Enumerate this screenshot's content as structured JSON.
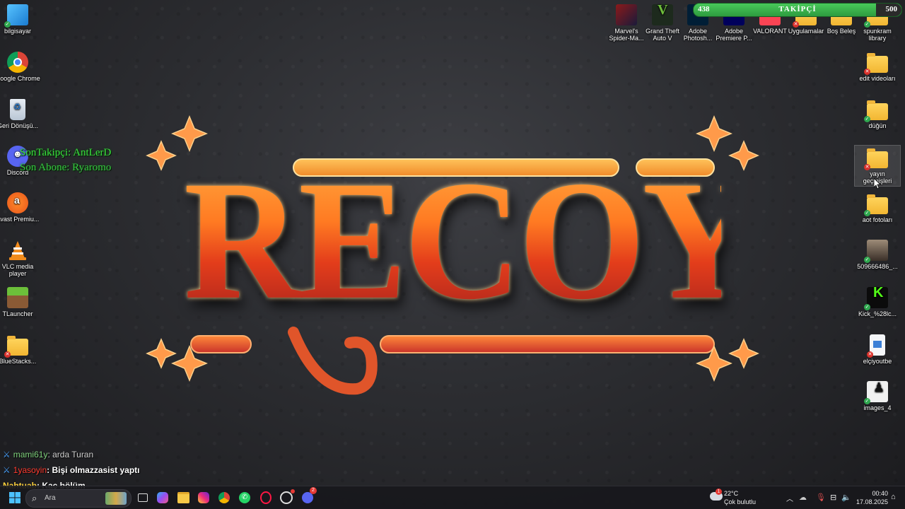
{
  "logo": {
    "text": "RECOYiN"
  },
  "desktop_left": [
    {
      "id": "bilgisayar",
      "label": "bilgisayar",
      "status": "ok"
    },
    {
      "id": "chrome",
      "label": "Google Chrome",
      "status": "shortcut"
    },
    {
      "id": "recycle",
      "label": "Geri Dönüşü...",
      "status": "none"
    },
    {
      "id": "discord",
      "label": "Discord",
      "status": "shortcut"
    },
    {
      "id": "avast",
      "label": "Avast Premiu...",
      "status": "shortcut"
    },
    {
      "id": "vlc",
      "label": "VLC media player",
      "status": "shortcut"
    },
    {
      "id": "tlauncher",
      "label": "TLauncher",
      "status": "shortcut"
    },
    {
      "id": "bluestacks",
      "label": "BlueStacks...",
      "status": "err"
    }
  ],
  "desktop_top": [
    {
      "id": "spiderman",
      "label": "Marvel's Spider-Ma..."
    },
    {
      "id": "gta",
      "label": "Grand Theft Auto V"
    },
    {
      "id": "photoshop",
      "label": "Adobe Photosh..."
    },
    {
      "id": "premiere",
      "label": "Adobe Premiere P..."
    },
    {
      "id": "valorant",
      "label": "VALORANT"
    },
    {
      "id": "uygulamalar",
      "label": "Uygulamalar"
    },
    {
      "id": "bos",
      "label": "Boş Beleş"
    },
    {
      "id": "spunkram",
      "label": "spunkram library"
    }
  ],
  "desktop_right": [
    {
      "id": "edit",
      "label": "edit videoları",
      "status": "err"
    },
    {
      "id": "dugun",
      "label": "düğün",
      "status": "ok"
    },
    {
      "id": "yayin",
      "label": "yayın geçmişleri",
      "status": "err"
    },
    {
      "id": "aot",
      "label": "aot fotoları",
      "status": "ok"
    },
    {
      "id": "photo509",
      "label": "509666486_...",
      "status": "ok"
    },
    {
      "id": "kick",
      "label": "Kick_%28lc...",
      "status": "ok"
    },
    {
      "id": "elciyoutbe",
      "label": "elçiyoutbe",
      "status": "err"
    },
    {
      "id": "images4",
      "label": "images_4",
      "status": "ok"
    }
  ],
  "overlay": {
    "son_takipci": "SonTakipçi: AntLerD",
    "son_abone": "Son Abone: Ryaromo",
    "follower_current": "438",
    "follower_label": "TAKİPÇİ",
    "follower_goal": "500",
    "follower_progress": 0.876
  },
  "chat": [
    {
      "user": "mami61y",
      "msg": ": arda Turan",
      "user_color": "#7ed07b",
      "msg_color": "#cfcfcf",
      "sword": true
    },
    {
      "user": "1yasoyin",
      "msg": ": Bişi olmazzasist yaptı",
      "user_color": "#ff3b2f",
      "msg_color": "#ffffff",
      "sword": true
    },
    {
      "user": "Nahtuab",
      "msg": ": Kaç bölüm",
      "user_color": "#ffd23f",
      "msg_color": "#ffffff",
      "sword": false
    }
  ],
  "taskbar": {
    "search_placeholder": "Ara",
    "weather_temp": "22°C",
    "weather_desc": "Çok bulutlu",
    "weather_badge": "1",
    "time": "00:40",
    "date": "17.08.2025",
    "discord_badge": "2"
  },
  "colors": {
    "accent_orange": "#ff7a22",
    "follower_green": "#3cbf50"
  }
}
